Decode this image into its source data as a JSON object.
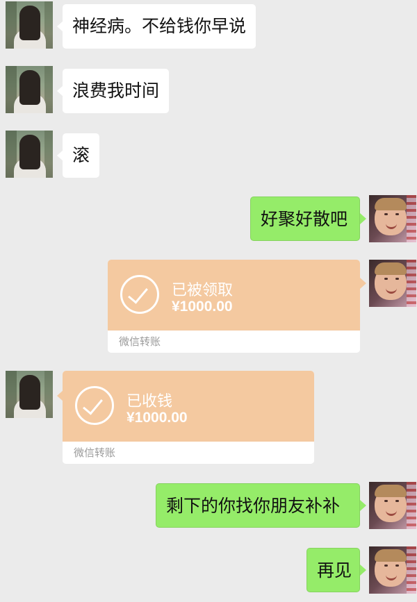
{
  "messages": [
    {
      "side": "left",
      "type": "text",
      "text": "神经病。不给钱你早说"
    },
    {
      "side": "left",
      "type": "text",
      "text": "浪费我时间"
    },
    {
      "side": "left",
      "type": "text",
      "text": "滚"
    },
    {
      "side": "right",
      "type": "text",
      "text": "好聚好散吧"
    },
    {
      "side": "right",
      "type": "transfer",
      "status": "已被领取",
      "amount": "¥1000.00",
      "footer": "微信转账"
    },
    {
      "side": "left",
      "type": "transfer",
      "status": "已收钱",
      "amount": "¥1000.00",
      "footer": "微信转账"
    },
    {
      "side": "right",
      "type": "text",
      "text": "剩下的你找你朋友补补"
    },
    {
      "side": "right",
      "type": "text",
      "text": "再见"
    }
  ],
  "colors": {
    "background": "#ebebeb",
    "received_bubble": "#ffffff",
    "sent_bubble": "#95ec69",
    "transfer_card": "#f4c9a0"
  }
}
